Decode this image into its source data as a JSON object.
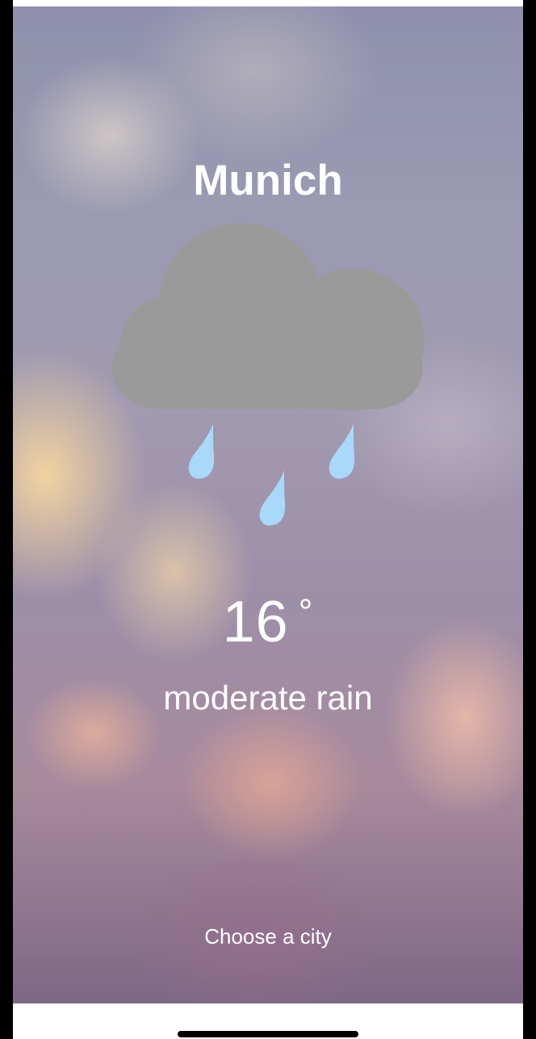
{
  "city": {
    "name": "Munich"
  },
  "weather": {
    "icon": "cloud-rain-icon",
    "temperature": "16",
    "degree_symbol": "°",
    "description": "moderate rain"
  },
  "actions": {
    "choose_city_label": "Choose a city"
  },
  "colors": {
    "cloud": "#9a9a9a",
    "raindrop": "#a9d8fb",
    "text": "#ffffff"
  }
}
